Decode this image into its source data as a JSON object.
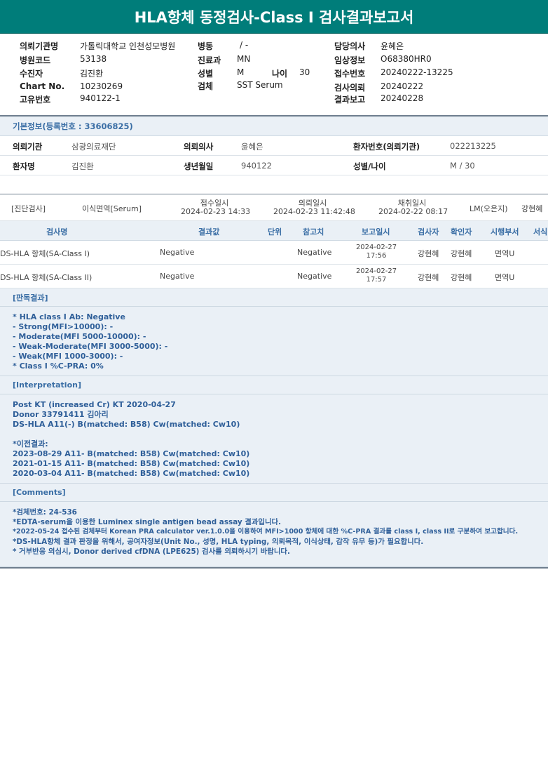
{
  "title": "HLA항체 동정검사-Class I 검사결과보고서",
  "header": {
    "labels": {
      "institution": "의뢰기관명",
      "hospital_code": "병원코드",
      "receiver": "수진자",
      "chart_no": "Chart No.",
      "unique_no": "고유번호",
      "ward": "병동",
      "department": "진료과",
      "sex": "성별",
      "age": "나이",
      "specimen": "검체",
      "doctor": "담당의사",
      "clinical_info": "임상정보",
      "receipt_no": "접수번호",
      "request_date": "검사의뢰",
      "report_date": "결과보고"
    },
    "values": {
      "institution": "가톨릭대학교 인천성모병원",
      "hospital_code": "53138",
      "receiver": "김진환",
      "chart_no": "10230269",
      "unique_no": "940122-1",
      "ward": "/ -",
      "department": "MN",
      "sex": "M",
      "age": "30",
      "specimen": "SST Serum",
      "doctor": "윤혜은",
      "clinical_info": "O68380HR0",
      "receipt_no": "20240222-13225",
      "request_date": "20240222",
      "report_date": "20240228"
    }
  },
  "basic_info": {
    "section_title": "기본정보(등록번호 : 33606825)",
    "row1": [
      {
        "label": "의뢰기관",
        "value": "삼광의료재단"
      },
      {
        "label": "의뢰의사",
        "value": "윤혜은"
      },
      {
        "label": "환자번호(의뢰기관)",
        "value": "022213225"
      }
    ],
    "row2": [
      {
        "label": "환자명",
        "value": "김진환"
      },
      {
        "label": "생년월일",
        "value": "940122"
      },
      {
        "label": "성별/나이",
        "value": "M / 30"
      }
    ]
  },
  "test_summary": {
    "category": "[진단검사]",
    "name": "이식면역[Serum]",
    "receipt_label": "접수일시",
    "receipt_value": "2024-02-23 14:33",
    "request_label": "의뢰일시",
    "request_value": "2024-02-23 11:42:48",
    "collect_label": "채취일시",
    "collect_value": "2024-02-22 08:17",
    "lm": "LM(오은지)",
    "tester": "강현혜"
  },
  "results_table": {
    "headers": [
      "검사명",
      "결과값",
      "단위",
      "참고치",
      "보고일시",
      "검사자",
      "확인자",
      "시행부서",
      "서식"
    ],
    "rows": [
      {
        "name": "DS-HLA 항체(SA-Class I)",
        "result": "Negative",
        "unit": "",
        "ref": "Negative",
        "date": "2024-02-27",
        "time": "17:56",
        "tester": "강현혜",
        "confirmer": "강현혜",
        "dept": "면역U"
      },
      {
        "name": "DS-HLA 항체(SA-Class II)",
        "result": "Negative",
        "unit": "",
        "ref": "Negative",
        "date": "2024-02-27",
        "time": "17:57",
        "tester": "강현혜",
        "confirmer": "강현혜",
        "dept": "면역U"
      }
    ]
  },
  "judgment": {
    "title": "[판독결과]",
    "lines": [
      "* HLA class I Ab: Negative",
      "- Strong(MFI>10000): -",
      "- Moderate(MFI 5000-10000): -",
      "- Weak-Moderate(MFI 3000-5000): -",
      "- Weak(MFI 1000-3000): -",
      "* Class I %C-PRA: 0%"
    ]
  },
  "interpretation": {
    "title": "[Interpretation]",
    "lines": [
      "Post KT (increased Cr) KT 2020-04-27",
      "Donor 33791411 김아리",
      "DS-HLA A11(-) B(matched: B58) Cw(matched: Cw10)",
      "",
      "*이전결과:",
      "2023-08-29 A11- B(matched: B58) Cw(matched: Cw10)",
      "2021-01-15 A11- B(matched: B58) Cw(matched: Cw10)",
      "2020-03-04 A11- B(matched: B58) Cw(matched: Cw10)"
    ]
  },
  "comments": {
    "title": "[Comments]",
    "lines": [
      "*검체번호: 24-536",
      "*EDTA-serum을 이용한 Luminex single antigen bead assay 결과입니다.",
      "*2022-05-24 접수된 검체부터 Korean PRA calculator ver.1.0.0을 이용하여 MFI>1000 항체에 대한 %C-PRA 결과를 class I, class II로 구분하여 보고합니다.",
      "*DS-HLA항체 결과 판정을 위해서, 공여자정보(Unit No., 성명, HLA typing, 의뢰목적, 이식상태, 감작 유무 등)가 필요합니다.",
      "* 거부반응 의심시, Donor derived cfDNA (LPE625) 검사를 의뢰하시기 바랍니다."
    ]
  }
}
